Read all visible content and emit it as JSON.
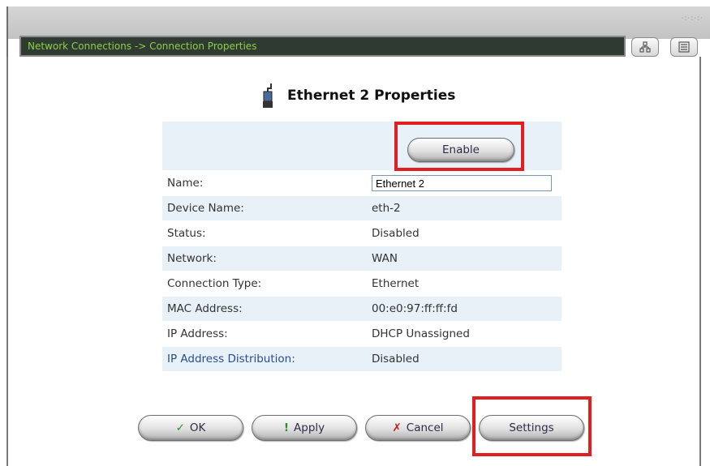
{
  "header": {
    "breadcrumb": "Network Connections -> Connection Properties",
    "grip": "·:·:·:·",
    "view_icons": [
      "network-map-icon",
      "list-view-icon"
    ]
  },
  "page": {
    "title": "Ethernet 2 Properties",
    "title_icon": "ethernet-plug-icon"
  },
  "enable_button": {
    "label": "Enable"
  },
  "properties": [
    {
      "label": "Name:",
      "value": "Ethernet 2",
      "editable": true
    },
    {
      "label": "Device Name:",
      "value": "eth-2"
    },
    {
      "label": "Status:",
      "value": "Disabled"
    },
    {
      "label": "Network:",
      "value": "WAN"
    },
    {
      "label": "Connection Type:",
      "value": "Ethernet"
    },
    {
      "label": "MAC Address:",
      "value": "00:e0:97:ff:ff:fd"
    },
    {
      "label": "IP Address:",
      "value": "DHCP Unassigned"
    },
    {
      "label": "IP Address Distribution:",
      "value": "Disabled",
      "link": true
    }
  ],
  "buttons": {
    "ok": {
      "label": "OK",
      "icon": "✓"
    },
    "apply": {
      "label": "Apply",
      "icon": "!"
    },
    "cancel": {
      "label": "Cancel",
      "icon": "✗"
    },
    "settings": {
      "label": "Settings"
    }
  },
  "colors": {
    "breadcrumb_bg": "#2f3a30",
    "breadcrumb_text": "#8ccf4a",
    "row_alt": "#e8f0f8",
    "highlight": "#e02020",
    "ok_icon": "#2e8b2e",
    "apply_icon": "#2e8b2e",
    "cancel_icon": "#c02020"
  }
}
